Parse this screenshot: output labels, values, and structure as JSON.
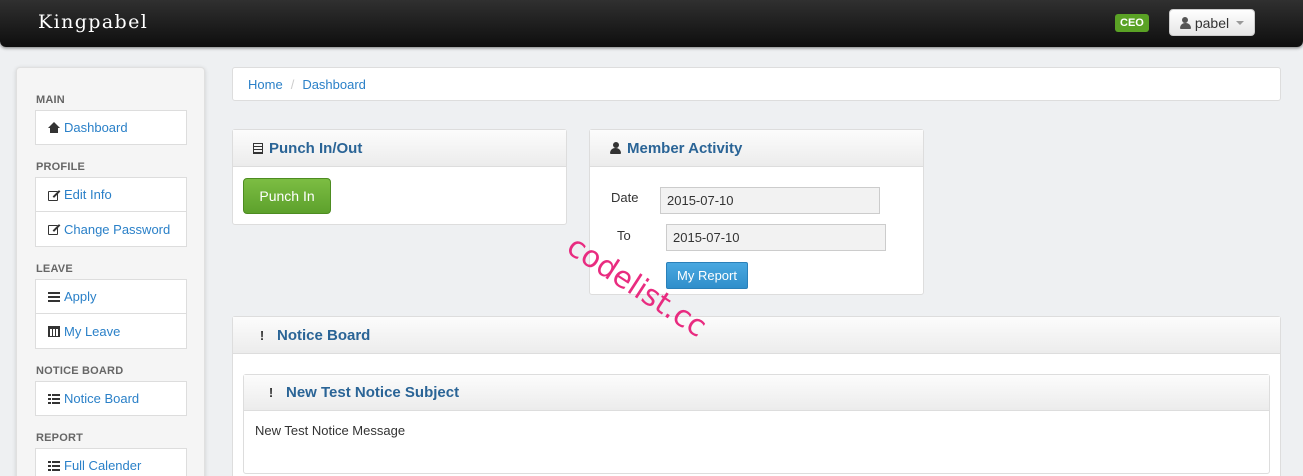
{
  "navbar": {
    "brand": "Kingpabel",
    "role_badge": "CEO",
    "user_name": "pabel"
  },
  "sidebar": {
    "sections": [
      {
        "header": "MAIN",
        "items": [
          {
            "label": "Dashboard",
            "icon": "home-icon"
          }
        ]
      },
      {
        "header": "PROFILE",
        "items": [
          {
            "label": "Edit Info",
            "icon": "edit-icon"
          },
          {
            "label": "Change Password",
            "icon": "edit-icon"
          }
        ]
      },
      {
        "header": "LEAVE",
        "items": [
          {
            "label": "Apply",
            "icon": "list-icon"
          },
          {
            "label": "My Leave",
            "icon": "calendar-icon"
          }
        ]
      },
      {
        "header": "NOTICE BOARD",
        "items": [
          {
            "label": "Notice Board",
            "icon": "bullets-icon"
          }
        ]
      },
      {
        "header": "REPORT",
        "items": [
          {
            "label": "Full Calender",
            "icon": "bullets-icon"
          }
        ]
      }
    ]
  },
  "breadcrumb": {
    "items": [
      "Home",
      "Dashboard"
    ],
    "separator": "/"
  },
  "punch": {
    "title": "Punch In/Out",
    "button_label": "Punch In"
  },
  "activity": {
    "title": "Member Activity",
    "date_label": "Date",
    "date_value": "2015-07-10",
    "to_label": "To",
    "to_value": "2015-07-10",
    "button_label": "My Report"
  },
  "notice_board": {
    "title": "Notice Board",
    "notices": [
      {
        "subject": "New Test Notice Subject",
        "message": "New Test Notice Message"
      }
    ]
  },
  "watermark": "codelist.cc",
  "colors": {
    "accent": "#2a80c8",
    "success": "#5da12c",
    "primary": "#2f8fcb",
    "badge": "#5aa225",
    "watermark": "#e8217a"
  }
}
